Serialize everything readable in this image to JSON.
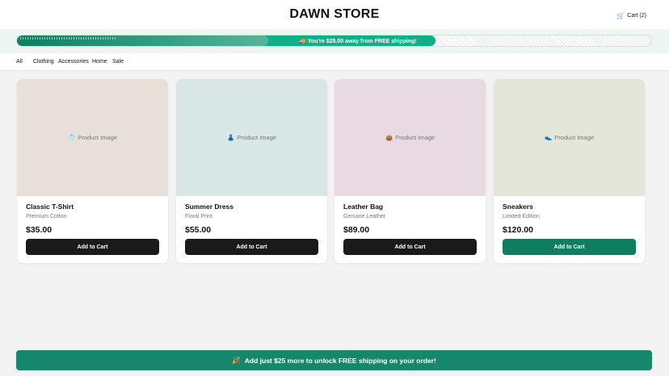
{
  "header": {
    "store_title": "DAWN STORE",
    "cart_icon": "cart-icon",
    "cart_label": "Cart (2)"
  },
  "shipping_progress": {
    "icon": "truck-icon",
    "message": "You're $25.00 away from FREE shipping!",
    "progress_fraction": 0.66,
    "fill_color": "#0db185"
  },
  "nav": {
    "items": [
      {
        "label": "All"
      },
      {
        "label": "Clothing"
      },
      {
        "label": "Accessories"
      },
      {
        "label": "Home"
      },
      {
        "label": "Sale"
      }
    ]
  },
  "products": [
    {
      "image_label": "Product Image",
      "image_icon": "shirt-icon",
      "image_glyph": "👕",
      "image_bg": "#e8dfd8",
      "name": "Classic T-Shirt",
      "subtitle": "Premium Cotton",
      "price": "$35.00",
      "button_label": "Add to Cart"
    },
    {
      "image_label": "Product Image",
      "image_icon": "dress-icon",
      "image_glyph": "👗",
      "image_bg": "#d9e6e6",
      "name": "Summer Dress",
      "subtitle": "Floral Print",
      "price": "$55.00",
      "button_label": "Add to Cart"
    },
    {
      "image_label": "Product Image",
      "image_icon": "bag-icon",
      "image_glyph": "👜",
      "image_bg": "#e8d9e2",
      "name": "Leather Bag",
      "subtitle": "Genuine Leather",
      "price": "$89.00",
      "button_label": "Add to Cart"
    },
    {
      "image_label": "Product Image",
      "image_icon": "sneaker-icon",
      "image_glyph": "👟",
      "image_bg": "#e3e6d8",
      "name": "Sneakers",
      "subtitle": "Limited Edition",
      "price": "$120.00",
      "button_label": "Add to Cart"
    }
  ],
  "bottom_banner": {
    "icon": "party-icon",
    "message": "Add just $25 more to unlock FREE shipping on your order!",
    "color": "#16876a"
  },
  "colors": {
    "primary_button": "#1a1a1a",
    "accent_button": "#0f7d5f"
  }
}
